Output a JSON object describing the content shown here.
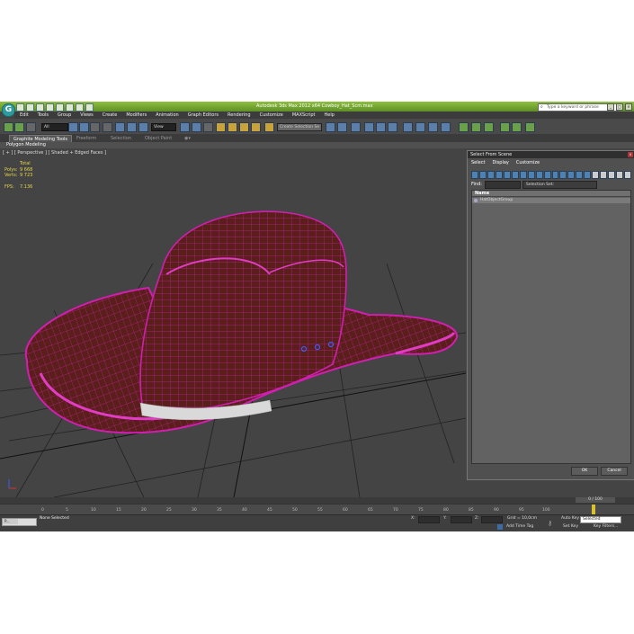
{
  "window": {
    "title": "Autodesk 3ds Max  2012 x64    Cowboy_Hat_Scm.max",
    "search_placeholder": "Type a keyword or phrase"
  },
  "menu": [
    "Edit",
    "Tools",
    "Group",
    "Views",
    "Create",
    "Modifiers",
    "Animation",
    "Graph Editors",
    "Rendering",
    "Customize",
    "MAXScript",
    "Help"
  ],
  "toolbar": {
    "selection_filter": "All",
    "ref_coord": "View",
    "selection_set": "Create Selection Se"
  },
  "ribbon": {
    "tabs": [
      "Graphite Modeling Tools",
      "Freeform",
      "Selection",
      "Object Paint"
    ],
    "panel_label": "Polygon Modeling"
  },
  "viewport": {
    "label": "[ + ] [ Perspective ] [ Shaded + Edged Faces ]",
    "stats": {
      "total_label": "Total",
      "polys_label": "Polys:",
      "polys_value": "9 668",
      "verts_label": "Verts:",
      "verts_value": "9 723",
      "fps_label": "FPS:",
      "fps_value": "7.136"
    }
  },
  "select_dialog": {
    "title": "Select From Scene",
    "close_glyph": "x",
    "menu": [
      "Select",
      "Display",
      "Customize"
    ],
    "find_label": "Find:",
    "selection_set": "Selection Set:",
    "column_name": "Name",
    "items": [
      "HatObjectGroup"
    ],
    "ok_label": "OK",
    "cancel_label": "Cancel"
  },
  "timeline": {
    "frame_counter": "0 / 100",
    "ticks": [
      "0",
      "5",
      "10",
      "15",
      "20",
      "25",
      "30",
      "35",
      "40",
      "45",
      "50",
      "55",
      "60",
      "65",
      "70",
      "75",
      "80",
      "85",
      "90",
      "95",
      "100"
    ]
  },
  "status": {
    "script_task": "P...",
    "selection_text": "None Selected",
    "x_label": "X:",
    "y_label": "Y:",
    "z_label": "Z:",
    "grid_text": "Grid = 10,0cm",
    "add_time_tag": "Add Time Tag",
    "auto_key": "Auto Key",
    "set_key": "Set Key",
    "selected_option": "Selected",
    "key_filters": "Key Filters..."
  },
  "colors": {
    "title_bar": "#7aab35",
    "wireframe": "#d01fb0",
    "hat_shade": "#5a1f1a",
    "hatband": "#d9d9d9",
    "stats_text": "#e5d64b"
  }
}
